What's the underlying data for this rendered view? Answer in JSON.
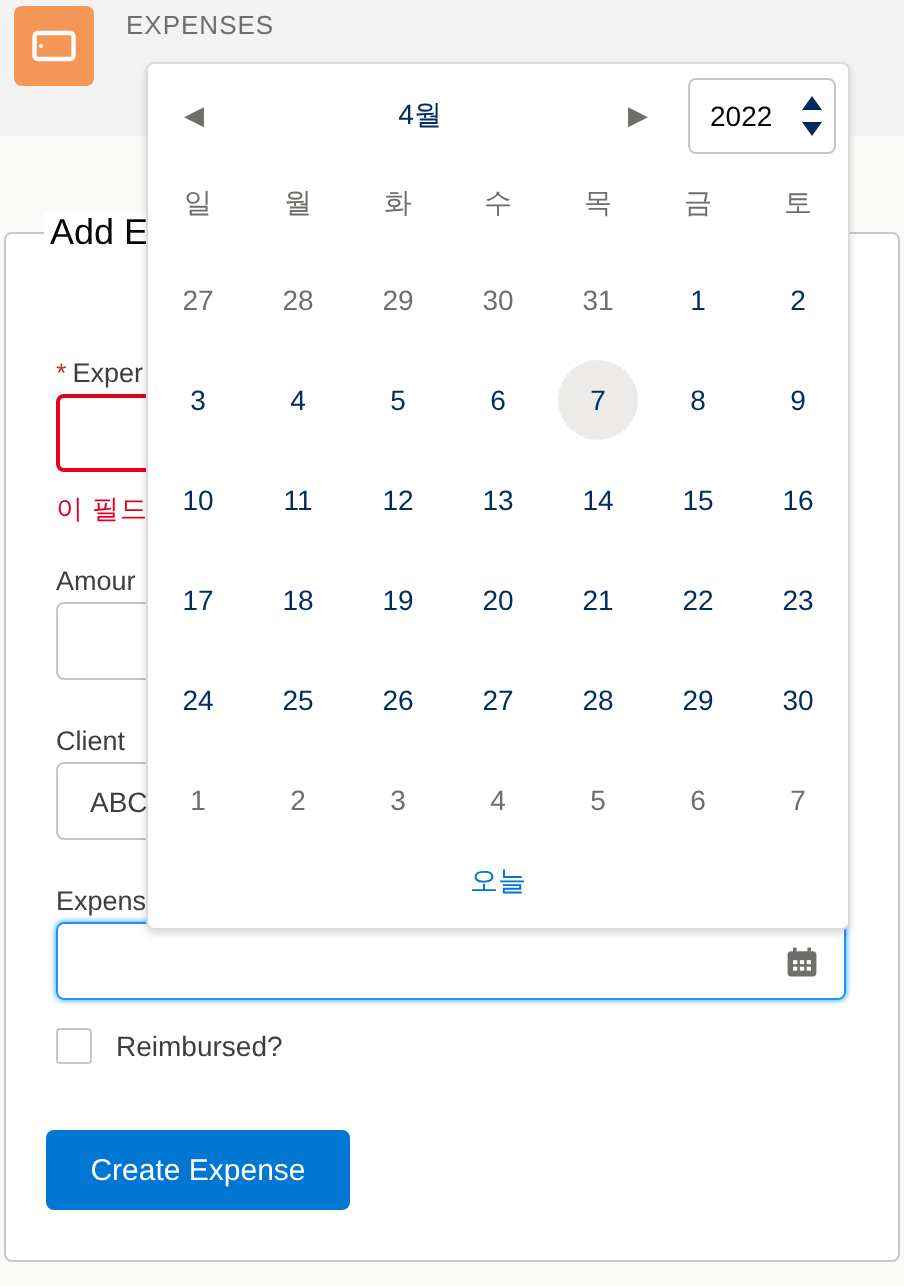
{
  "header": {
    "object_label": "EXPENSES"
  },
  "form": {
    "legend": "Add E",
    "fields": [
      {
        "kind": "text",
        "required_mark": "*",
        "label": "Exper",
        "error": true,
        "error_text": "이 필드"
      },
      {
        "kind": "text",
        "label": "Amour",
        "error": false
      },
      {
        "kind": "select",
        "label": "Client",
        "value": "ABC",
        "error": false
      },
      {
        "kind": "date",
        "label": "Expens",
        "error": false,
        "focused": true
      }
    ],
    "checkbox": {
      "label": "Reimbursed?",
      "checked": false
    },
    "button": "Create Expense"
  },
  "datepicker": {
    "prev": "◀",
    "month": "4월",
    "next": "▶",
    "year": "2022",
    "weekdays": [
      "일",
      "월",
      "화",
      "수",
      "목",
      "금",
      "토"
    ],
    "weeks": [
      [
        {
          "day": "27",
          "outside": true,
          "today": false
        },
        {
          "day": "28",
          "outside": true,
          "today": false
        },
        {
          "day": "29",
          "outside": true,
          "today": false
        },
        {
          "day": "30",
          "outside": true,
          "today": false
        },
        {
          "day": "31",
          "outside": true,
          "today": false
        },
        {
          "day": "1",
          "outside": false,
          "today": false
        },
        {
          "day": "2",
          "outside": false,
          "today": false
        }
      ],
      [
        {
          "day": "3",
          "outside": false,
          "today": false
        },
        {
          "day": "4",
          "outside": false,
          "today": false
        },
        {
          "day": "5",
          "outside": false,
          "today": false
        },
        {
          "day": "6",
          "outside": false,
          "today": false
        },
        {
          "day": "7",
          "outside": false,
          "today": true
        },
        {
          "day": "8",
          "outside": false,
          "today": false
        },
        {
          "day": "9",
          "outside": false,
          "today": false
        }
      ],
      [
        {
          "day": "10",
          "outside": false,
          "today": false
        },
        {
          "day": "11",
          "outside": false,
          "today": false
        },
        {
          "day": "12",
          "outside": false,
          "today": false
        },
        {
          "day": "13",
          "outside": false,
          "today": false
        },
        {
          "day": "14",
          "outside": false,
          "today": false
        },
        {
          "day": "15",
          "outside": false,
          "today": false
        },
        {
          "day": "16",
          "outside": false,
          "today": false
        }
      ],
      [
        {
          "day": "17",
          "outside": false,
          "today": false
        },
        {
          "day": "18",
          "outside": false,
          "today": false
        },
        {
          "day": "19",
          "outside": false,
          "today": false
        },
        {
          "day": "20",
          "outside": false,
          "today": false
        },
        {
          "day": "21",
          "outside": false,
          "today": false
        },
        {
          "day": "22",
          "outside": false,
          "today": false
        },
        {
          "day": "23",
          "outside": false,
          "today": false
        }
      ],
      [
        {
          "day": "24",
          "outside": false,
          "today": false
        },
        {
          "day": "25",
          "outside": false,
          "today": false
        },
        {
          "day": "26",
          "outside": false,
          "today": false
        },
        {
          "day": "27",
          "outside": false,
          "today": false
        },
        {
          "day": "28",
          "outside": false,
          "today": false
        },
        {
          "day": "29",
          "outside": false,
          "today": false
        },
        {
          "day": "30",
          "outside": false,
          "today": false
        }
      ],
      [
        {
          "day": "1",
          "outside": true,
          "today": false
        },
        {
          "day": "2",
          "outside": true,
          "today": false
        },
        {
          "day": "3",
          "outside": true,
          "today": false
        },
        {
          "day": "4",
          "outside": true,
          "today": false
        },
        {
          "day": "5",
          "outside": true,
          "today": false
        },
        {
          "day": "6",
          "outside": true,
          "today": false
        },
        {
          "day": "7",
          "outside": true,
          "today": false
        }
      ]
    ],
    "today_link": "오늘"
  }
}
